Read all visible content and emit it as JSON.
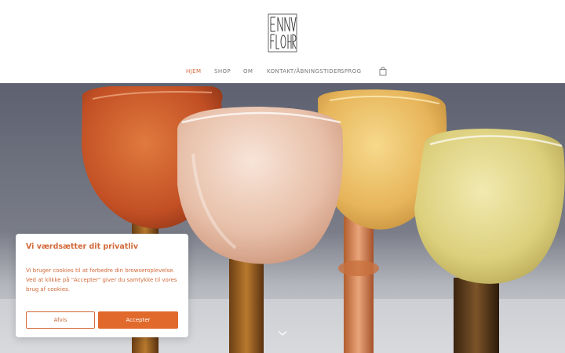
{
  "brand": {
    "logo_text_top": "ENNV",
    "logo_text_bottom": "FLOHR"
  },
  "nav": {
    "items": [
      {
        "label": "HJEM",
        "active": true
      },
      {
        "label": "SHOP",
        "active": false
      },
      {
        "label": "OM",
        "active": false
      },
      {
        "label": "KONTAKT/ÅBNINGSTIDER",
        "active": false
      },
      {
        "label": "SPROG",
        "active": false
      }
    ],
    "cart_icon": "shopping-bag-icon"
  },
  "hero": {
    "scroll_icon": "chevron-down-icon"
  },
  "cookie": {
    "title": "Vi værdsætter dit privatliv",
    "body": "Vi bruger cookies til at forbedre din browseroplevelse. Ved at klikke på \"Accepter\" giver du samtykke til vores brug af cookies.",
    "decline_label": "Afvis",
    "accept_label": "Accepter"
  },
  "colors": {
    "accent": "#d2693a",
    "button": "#e0692b",
    "nav_text": "#777777"
  }
}
